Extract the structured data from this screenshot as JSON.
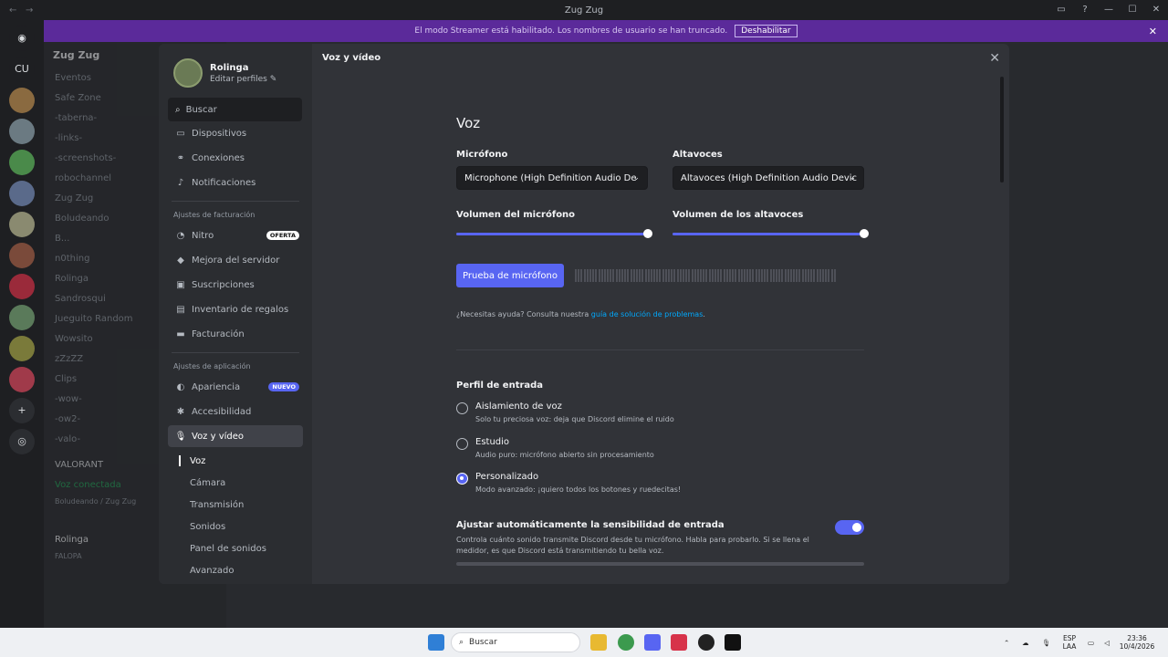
{
  "window": {
    "title": "Zug Zug"
  },
  "banner": {
    "text": "El modo Streamer está habilitado. Los nombres de usuario se han truncado.",
    "disable_label": "Deshabilitar"
  },
  "background": {
    "server_name": "Zug Zug",
    "rail_label": "CU",
    "channels": [
      "Eventos",
      "Safe Zone",
      "-taberna-",
      "-links-",
      "-screenshots-",
      "robochannel",
      "Zug Zug",
      "Boludeando",
      "B...",
      "n0thing",
      "Rolinga",
      "Sandrosqui",
      "Jueguito Random",
      "Wowsito",
      "zZzZZ",
      "Clips",
      "-wow-",
      "-ow2-",
      "-valo-"
    ],
    "activity": "VALORANT",
    "voice_status": "Voz conectada",
    "voice_channel": "Boludeando / Zug Zug",
    "user_name": "Rolinga",
    "user_status": "FALOPA"
  },
  "profile": {
    "name": "Rolinga",
    "edit_label": "Editar perfiles"
  },
  "search": {
    "placeholder": "Buscar"
  },
  "nav": {
    "items_top": [
      {
        "label": "Dispositivos",
        "icon": "devices-icon"
      },
      {
        "label": "Conexiones",
        "icon": "link-icon"
      },
      {
        "label": "Notificaciones",
        "icon": "bell-icon"
      }
    ],
    "billing_header": "Ajustes de facturación",
    "billing_items": [
      {
        "label": "Nitro",
        "icon": "nitro-icon",
        "badge": "OFERTA"
      },
      {
        "label": "Mejora del servidor",
        "icon": "boost-icon"
      },
      {
        "label": "Suscripciones",
        "icon": "subscriptions-icon"
      },
      {
        "label": "Inventario de regalos",
        "icon": "gift-icon"
      },
      {
        "label": "Facturación",
        "icon": "card-icon"
      }
    ],
    "app_header": "Ajustes de aplicación",
    "app_items": [
      {
        "label": "Apariencia",
        "icon": "palette-icon",
        "badge": "NUEVO"
      },
      {
        "label": "Accesibilidad",
        "icon": "accessibility-icon"
      },
      {
        "label": "Voz y vídeo",
        "icon": "microphone-icon"
      }
    ],
    "sub_items": [
      "Voz",
      "Cámara",
      "Transmisión",
      "Sonidos",
      "Panel de sonidos",
      "Avanzado"
    ]
  },
  "main": {
    "title": "Voz y vídeo",
    "section_title": "Voz",
    "mic_label": "Micrófono",
    "mic_value": "Microphone (High Definition Audio De",
    "speaker_label": "Altavoces",
    "speaker_value": "Altavoces (High Definition Audio Devic",
    "mic_volume_label": "Volumen del micrófono",
    "speaker_volume_label": "Volumen de los altavoces",
    "mic_volume": 100,
    "speaker_volume": 100,
    "test_button": "Prueba de micrófono",
    "help_text": "¿Necesitas ayuda? Consulta nuestra ",
    "help_link": "guía de solución de problemas",
    "help_end": ".",
    "input_profile_label": "Perfil de entrada",
    "profiles": [
      {
        "title": "Aislamiento de voz",
        "desc": "Solo tu preciosa voz: deja que Discord elimine el ruido",
        "selected": false
      },
      {
        "title": "Estudio",
        "desc": "Audio puro: micrófono abierto sin procesamiento",
        "selected": false
      },
      {
        "title": "Personalizado",
        "desc": "Modo avanzado: ¡quiero todos los botones y ruedecitas!",
        "selected": true
      }
    ],
    "auto_sens_label": "Ajustar automáticamente la sensibilidad de entrada",
    "auto_sens_desc": "Controla cuánto sonido transmite Discord desde tu micrófono. Habla para probarlo. Si se llena el medidor, es que Discord está transmitiendo tu bella voz.",
    "auto_sens_enabled": true,
    "accent": "#5865f2"
  },
  "taskbar": {
    "search_placeholder": "Buscar",
    "lang": "ESP",
    "lang2": "LAA",
    "time": "23:36",
    "date": "10/4/2026"
  }
}
